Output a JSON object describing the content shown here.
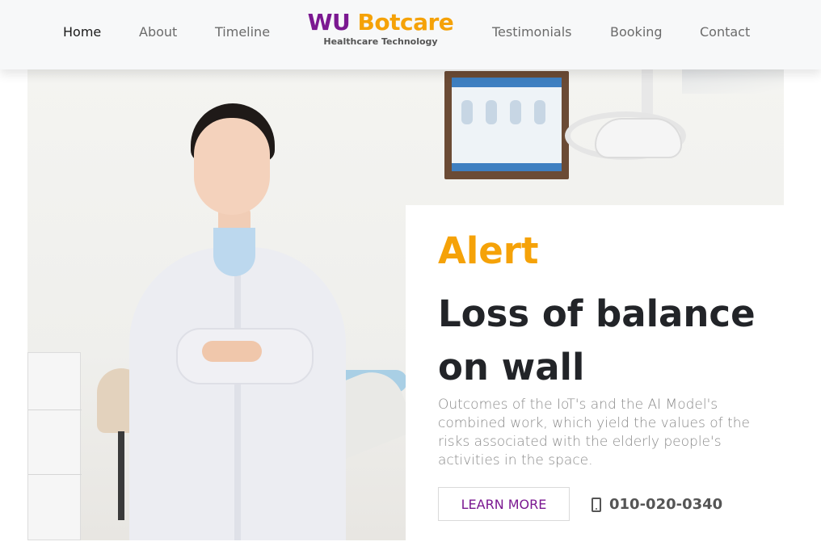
{
  "nav": {
    "home": "Home",
    "about": "About",
    "timeline": "Timeline",
    "testimonials": "Testimonials",
    "booking": "Booking",
    "contact": "Contact"
  },
  "brand": {
    "part1": "WU",
    "part2": "Botcare",
    "subtitle": "Healthcare Technology"
  },
  "hero": {
    "image_alt": "Smiling doctor in white coat standing in a dental clinic",
    "alert_label": "Alert",
    "headline": "Loss of balance on wall",
    "description": "Outcomes of the IoT's and the AI Model's combined work, which yield the values of the risks associated with the elderly people's activities in the space.",
    "cta_label": "LEARN MORE",
    "phone_icon": "mobile-phone-icon",
    "phone": "010-020-0340"
  },
  "colors": {
    "brand_purple": "#7b1891",
    "brand_orange": "#f5a208",
    "headline": "#222428",
    "nav_active": "#1a1a1a",
    "nav": "#6b6b6b"
  }
}
